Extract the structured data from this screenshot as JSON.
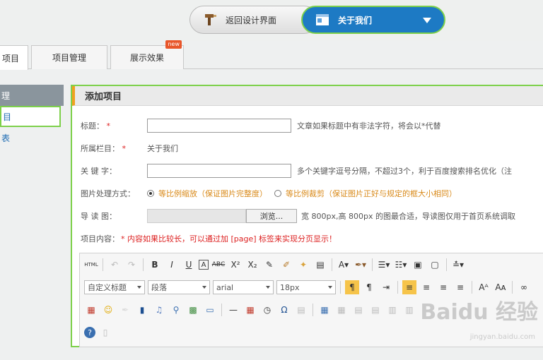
{
  "topbar": {
    "back_label": "返回设计界面",
    "nav_selected": "关于我们"
  },
  "tabs": [
    {
      "label": "项目"
    },
    {
      "label": "项目管理"
    },
    {
      "label": "展示效果",
      "badge": "new"
    }
  ],
  "sidebar": {
    "head": "理",
    "items": [
      {
        "label": "目"
      },
      {
        "label": "表"
      }
    ]
  },
  "panel": {
    "title": "添加项目",
    "title_label": "标题：",
    "title_hint": "文章如果标题中有非法字符，将会以*代替",
    "column_label": "所属栏目：",
    "column_value": "关于我们",
    "keyword_label": "关 键 字：",
    "keyword_hint": "多个关键字逗号分隔，不超过3个，利于百度搜索排名优化（注",
    "image_mode_label": "图片处理方式：",
    "image_mode_option1": "等比例缩放（保证图片完整度）",
    "image_mode_option2": "等比例裁剪（保证图片正好与规定的框大小相同）",
    "guide_label": "导 读 图：",
    "browse_label": "浏览...",
    "guide_hint": "宽 800px,高 800px 的图最合适，导读图仅用于首页系统调取",
    "content_label": "项目内容：",
    "content_hint": "* 内容如果比较长，可以通过加 [page] 标签来实现分页显示！"
  },
  "editor": {
    "heading_select": "自定义标题",
    "paragraph_select": "段落",
    "font_select": "arial",
    "size_select": "18px"
  },
  "watermark": {
    "text": "Baidu 经验",
    "sub": "jingyan.baidu.com"
  }
}
